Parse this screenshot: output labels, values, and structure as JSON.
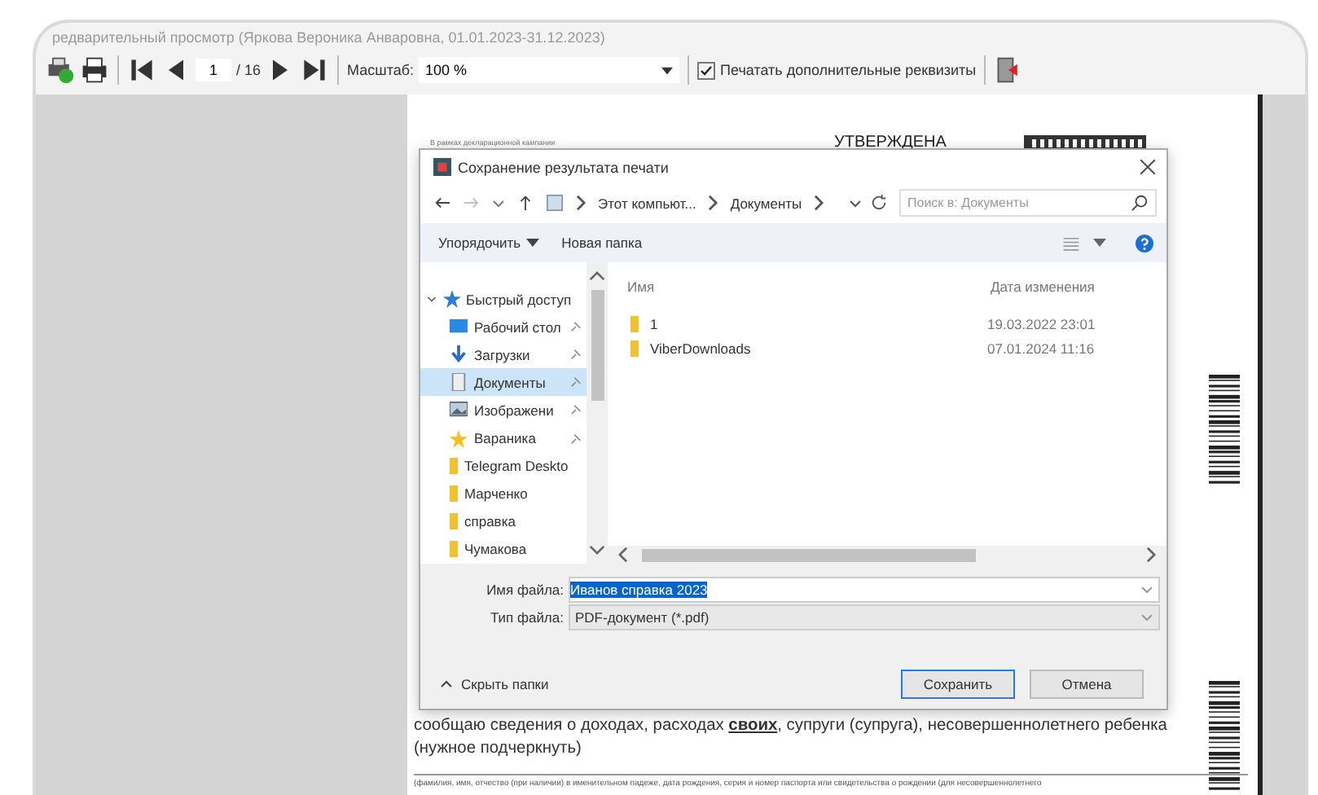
{
  "window": {
    "title": "редварительный просмотр (Яркова Вероника Анваровна, 01.01.2023-31.12.2023)"
  },
  "toolbar": {
    "page": "1",
    "total": "/ 16",
    "zoom_label": "Масштаб:",
    "zoom_value": "100 %",
    "print_extra": {
      "label": "Печатать дополнительные реквизиты",
      "checked": true
    }
  },
  "document": {
    "header_note": "В рамках декларационной кампании",
    "approved": "УТВЕРЖДЕНА",
    "body": "сообщаю сведения о доходах, расходах **своих**, супруги (супруга), несовершеннолетнего ребенка (нужное подчеркнуть)",
    "footnote": "(фамилия, имя, отчество (при наличии) в именительном падеже, дата рождения, серия и номер паспорта или свидетельства о рождении (для несовершеннолетнего"
  },
  "dialog": {
    "title": "Сохранение результата печати",
    "breadcrumb": [
      "Этот компьют...",
      "Документы"
    ],
    "search": {
      "placeholder": "Поиск в: Документы"
    },
    "organize": "Упорядочить",
    "new_folder": "Новая папка",
    "columns": [
      "Имя",
      "Дата изменения"
    ],
    "files": [
      {
        "name": "1",
        "date": "19.03.2022 23:01"
      },
      {
        "name": "ViberDownloads",
        "date": "07.01.2024 11:16"
      }
    ],
    "nav": {
      "label": "Быстрый доступ",
      "expanded": true,
      "children": [
        {
          "label": "Рабочий стол",
          "kind": "desktop",
          "pinned": true,
          "selected": false
        },
        {
          "label": "Загрузки",
          "kind": "download",
          "pinned": true,
          "selected": false
        },
        {
          "label": "Документы",
          "kind": "documents",
          "pinned": true,
          "selected": true
        },
        {
          "label": "Изображени",
          "kind": "images",
          "pinned": true,
          "selected": false
        },
        {
          "label": "Вараника",
          "kind": "user",
          "pinned": true,
          "selected": false
        },
        {
          "label": "Telegram Deskto",
          "kind": "folder",
          "pinned": false,
          "selected": false
        },
        {
          "label": "Марченко",
          "kind": "folder",
          "pinned": false,
          "selected": false
        },
        {
          "label": "справка",
          "kind": "folder",
          "pinned": false,
          "selected": false
        },
        {
          "label": "Чумакова",
          "kind": "folder",
          "pinned": false,
          "selected": false
        }
      ]
    },
    "filename": {
      "label": "Имя файла:",
      "value": "Иванов справка 2023"
    },
    "filetype": {
      "label": "Тип файла:",
      "value": "PDF-документ (*.pdf)"
    },
    "hide_folders": "Скрыть папки",
    "buttons": [
      {
        "label": "Сохранить",
        "default": true
      },
      {
        "label": "Отмена",
        "default": false
      }
    ]
  }
}
